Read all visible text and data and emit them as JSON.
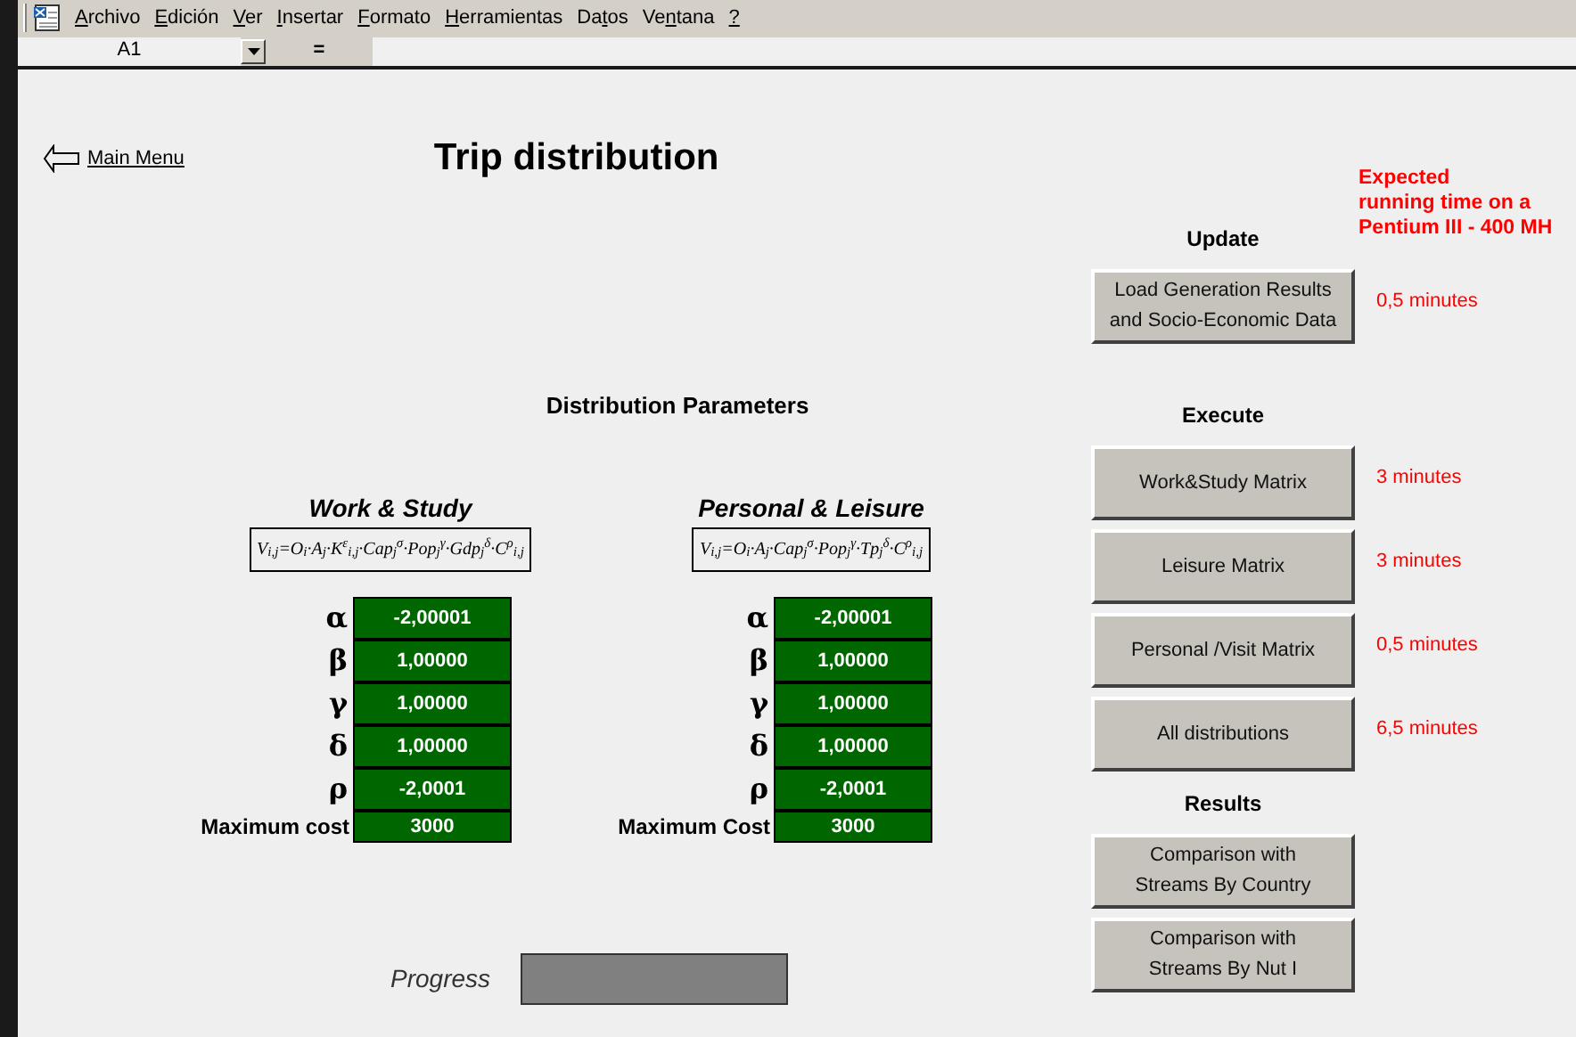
{
  "menu_bar": {
    "items": [
      {
        "key": "A",
        "after": "rchivo"
      },
      {
        "key": "E",
        "after": "dición"
      },
      {
        "key": "V",
        "after": "er"
      },
      {
        "key": "I",
        "after": "nsertar"
      },
      {
        "key": "F",
        "after": "ormato"
      },
      {
        "key": "H",
        "after": "erramientas"
      },
      {
        "before": "Da",
        "key": "t",
        "after": "os"
      },
      {
        "before": "Ve",
        "key": "n",
        "after": "tana"
      },
      {
        "key": "?"
      }
    ]
  },
  "formula_bar": {
    "cell_reference": "A1",
    "equals": "="
  },
  "sheet": {
    "main_menu_link": "Main Menu",
    "title": "Trip distribution",
    "section_title": "Distribution Parameters",
    "models": [
      {
        "title": "Work & Study",
        "formula": "V$_{i,j}$=O$_{i}$·A$_{j}$·K$^{ε}$$_{i,j}$·Cap$_{j}$$^{σ}$·Pop$_{j}$$^{γ}$·Gdp$_{j}$$^{δ}$·C$^{ρ}$$_{i,j}$",
        "parameters": [
          {
            "symbol": "α",
            "value": "-2,00001"
          },
          {
            "symbol": "β",
            "value": "1,00000"
          },
          {
            "symbol": "γ",
            "value": "1,00000"
          },
          {
            "symbol": "δ",
            "value": "1,00000"
          },
          {
            "symbol": "ρ",
            "value": "-2,0001"
          },
          {
            "symbol": "Maximum cost",
            "value": "3000",
            "kind": "cost"
          }
        ]
      },
      {
        "title": "Personal & Leisure",
        "formula": "V$_{i,j}$=O$_{i}$·A$_{j}$·Cap$_{j}$$^{σ}$·Pop$_{j}$$^{γ}$·Tp$_{j}$$^{δ}$·C$^{ρ}$$_{i,j}$",
        "parameters": [
          {
            "symbol": "α",
            "value": "-2,00001"
          },
          {
            "symbol": "β",
            "value": "1,00000"
          },
          {
            "symbol": "γ",
            "value": "1,00000"
          },
          {
            "symbol": "δ",
            "value": "1,00000"
          },
          {
            "symbol": "ρ",
            "value": "-2,0001"
          },
          {
            "symbol": "Maximum Cost",
            "value": "3000",
            "kind": "cost"
          }
        ]
      }
    ],
    "progress": {
      "label": "Progress",
      "level": 0
    }
  },
  "panel": {
    "note": "Expected\nrunning time on a\nPentium III - 400 MH",
    "sections": [
      {
        "heading": "Update",
        "buttons": [
          {
            "label": "Load Generation Results\nand Socio-Economic Data",
            "time": "0,5 minutes"
          }
        ]
      },
      {
        "heading": "Execute",
        "buttons": [
          {
            "label": "Work&Study Matrix",
            "time": "3 minutes"
          },
          {
            "label": "Leisure Matrix",
            "time": "3 minutes"
          },
          {
            "label": "Personal /Visit Matrix",
            "time": "0,5 minutes"
          },
          {
            "label": "All distributions",
            "time": "6,5 minutes"
          }
        ]
      },
      {
        "heading": "Results",
        "buttons": [
          {
            "label": "Comparison with\nStreams By Country"
          },
          {
            "label": "Comparison with\nStreams By Nut I"
          }
        ]
      }
    ]
  }
}
